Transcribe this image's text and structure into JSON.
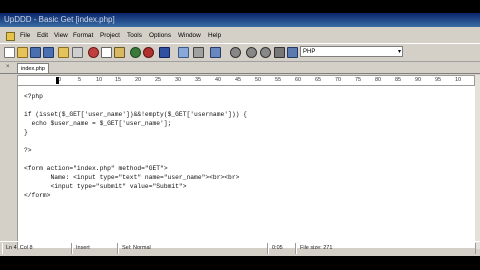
{
  "window": {
    "title": "UpDDD - Basic Get [index.php]"
  },
  "menu": {
    "items": [
      "File",
      "Edit",
      "View",
      "Format",
      "Project",
      "Tools",
      "Options",
      "Window",
      "Help"
    ]
  },
  "toolbar": {
    "language": "PHP",
    "icons": [
      "new-file-icon",
      "open-icon",
      "save-icon",
      "save-all-icon",
      "open-folder-icon",
      "print-icon",
      "cut-icon",
      "copy-icon",
      "paste-icon",
      "undo-icon",
      "redo-icon",
      "fullscreen-icon",
      "ftp-icon",
      "tag-icon",
      "find-icon",
      "find-next-icon",
      "replace-icon",
      "goto-icon",
      "run-icon",
      "browser-icon"
    ]
  },
  "tabs": [
    {
      "label": "index.php",
      "active": true
    }
  ],
  "ruler": {
    "labels": [
      "0",
      "5",
      "10",
      "15",
      "20",
      "25",
      "30",
      "35",
      "40",
      "45",
      "50",
      "55",
      "60",
      "65",
      "70",
      "75",
      "80",
      "85",
      "90",
      "95",
      "10"
    ]
  },
  "editor": {
    "lines": [
      "<?php",
      "",
      "if (isset($_GET['user_name'])&&!empty($_GET['username'])) {",
      "  echo $user_name = $_GET['user_name'];",
      "}",
      "",
      "?>",
      "",
      "<form action=\"index.php\" method=\"GET\">",
      "       Name: <input type=\"text\" name=\"user_name\"><br><br>",
      "       <input type=\"submit\" value=\"Submit\">",
      "</form>"
    ]
  },
  "status": {
    "position": "Ln 4, Col 8",
    "mode": "Insert",
    "selection": "Sel: Normal",
    "time": "0:05",
    "file_size": "File size: 271"
  }
}
